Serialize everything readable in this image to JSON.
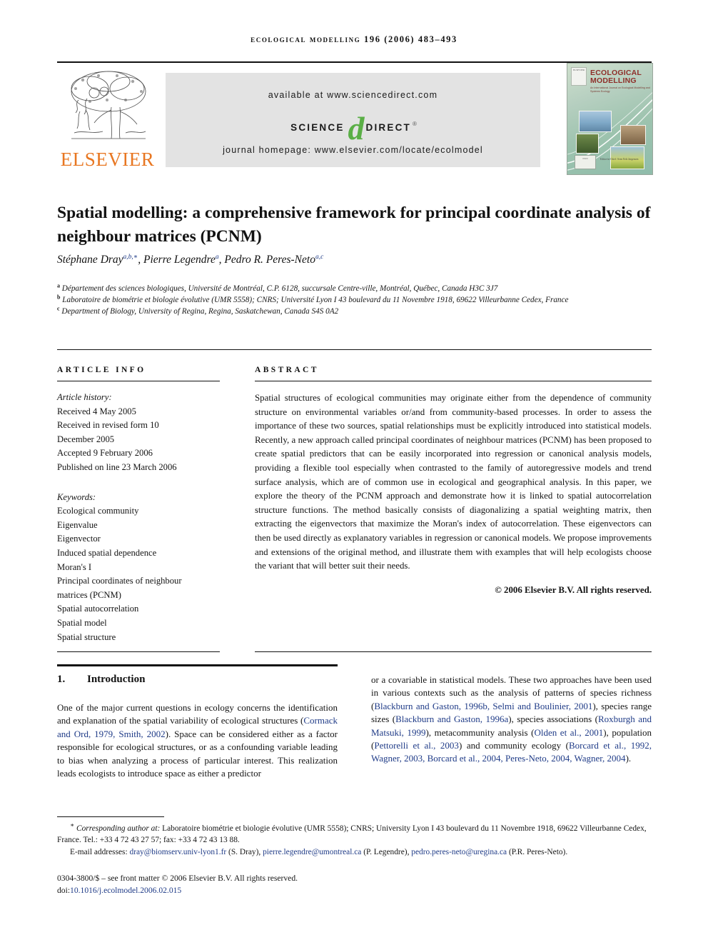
{
  "running_head": "Ecological Modelling 196 (2006) 483–493",
  "banner": {
    "publisher_name": "ELSEVIER",
    "available_at": "available at www.sciencedirect.com",
    "sciencedirect_science": "SCIENCE",
    "sciencedirect_d": "d",
    "sciencedirect_direct": "DIRECT",
    "sciencedirect_reg": "®",
    "journal_homepage": "journal homepage: www.elsevier.com/locate/ecolmodel",
    "cover": {
      "publisher_block": "ELSEVIER",
      "title": "ECOLOGICAL MODELLING",
      "subtitle": "An International Journal on Ecological Modelling and Systems Ecology",
      "issn_block": "ISSN",
      "editor": "Editor-in-Chief: Sven Erik Jørgensen"
    }
  },
  "article": {
    "title": "Spatial modelling: a comprehensive framework for principal coordinate analysis of neighbour matrices (PCNM)",
    "authors_html": "Stéphane Dray<sup>a,b,∗</sup>, Pierre Legendre<sup>a</sup>, Pedro R. Peres-Neto<sup>a,c</sup>",
    "affiliations": [
      {
        "marker": "a",
        "text": "Département des sciences biologiques, Université de Montréal, C.P. 6128, succursale Centre-ville, Montréal, Québec, Canada H3C 3J7"
      },
      {
        "marker": "b",
        "text": "Laboratoire de biométrie et biologie évolutive (UMR 5558); CNRS; Université Lyon I 43 boulevard du 11 Novembre 1918, 69622 Villeurbanne Cedex, France"
      },
      {
        "marker": "c",
        "text": "Department of Biology, University of Regina, Regina, Saskatchewan, Canada S4S 0A2"
      }
    ]
  },
  "article_info": {
    "label": "ARTICLE INFO",
    "history_label": "Article history:",
    "history": [
      "Received 4 May 2005",
      "Received in revised form 10",
      "December 2005",
      "Accepted 9 February 2006",
      "Published on line 23 March 2006"
    ],
    "keywords_label": "Keywords:",
    "keywords": [
      "Ecological community",
      "Eigenvalue",
      "Eigenvector",
      "Induced spatial dependence",
      "Moran's I",
      "Principal coordinates of neighbour",
      "matrices (PCNM)",
      "Spatial autocorrelation",
      "Spatial model",
      "Spatial structure"
    ]
  },
  "abstract": {
    "label": "ABSTRACT",
    "text": "Spatial structures of ecological communities may originate either from the dependence of community structure on environmental variables or/and from community-based processes. In order to assess the importance of these two sources, spatial relationships must be explicitly introduced into statistical models. Recently, a new approach called principal coordinates of neighbour matrices (PCNM) has been proposed to create spatial predictors that can be easily incorporated into regression or canonical analysis models, providing a flexible tool especially when contrasted to the family of autoregressive models and trend surface analysis, which are of common use in ecological and geographical analysis. In this paper, we explore the theory of the PCNM approach and demonstrate how it is linked to spatial autocorrelation structure functions. The method basically consists of diagonalizing a spatial weighting matrix, then extracting the eigenvectors that maximize the Moran's index of autocorrelation. These eigenvectors can then be used directly as explanatory variables in regression or canonical models. We propose improvements and extensions of the original method, and illustrate them with examples that will help ecologists choose the variant that will better suit their needs.",
    "copyright": "© 2006 Elsevier B.V. All rights reserved."
  },
  "introduction": {
    "number": "1.",
    "heading": "Introduction",
    "left_column_html": "One of the major current questions in ecology concerns the identification and explanation of the spatial variability of ecological structures (<span class=\"cit\">Cormack and Ord, 1979, Smith, 2002</span>). Space can be considered either as a factor responsible for ecological structures, or as a confounding variable leading to bias when analyzing a process of particular interest. This realization leads ecologists to introduce space as either a predictor",
    "right_column_html": "or a covariable in statistical models. These two approaches have been used in various contexts such as the analysis of patterns of species richness (<span class=\"cit\">Blackburn and Gaston, 1996b, Selmi and Boulinier, 2001</span>), species range sizes (<span class=\"cit\">Blackburn and Gaston, 1996a</span>), species associations (<span class=\"cit\">Roxburgh and Matsuki, 1999</span>), metacommunity analysis (<span class=\"cit\">Olden et al., 2001</span>), population (<span class=\"cit\">Pettorelli et al., 2003</span>) and community ecology (<span class=\"cit\">Borcard et al., 1992, Wagner, 2003, Borcard et al., 2004, Peres-Neto, 2004, Wagner, 2004</span>)."
  },
  "footnotes": {
    "corresponding_html": "<sup>∗</sup> <span class=\"corr\">Corresponding author at:</span> Laboratoire biométrie et biologie évolutive (UMR 5558); CNRS; University Lyon I 43 boulevard du 11 Novembre 1918, 69622 Villeurbanne Cedex, France. Tel.: +33 4 72 43 27 57; fax: +33 4 72 43 13 88.",
    "emails_html": "E-mail addresses: <span class=\"link\">dray@biomserv.univ-lyon1.fr</span> (S. Dray), <span class=\"link\">pierre.legendre@umontreal.ca</span> (P. Legendre), <span class=\"link\">pedro.peres-neto@uregina.ca</span> (P.R. Peres-Neto)."
  },
  "imprint": {
    "front_matter": "0304-3800/$ – see front matter © 2006 Elsevier B.V. All rights reserved.",
    "doi_prefix": "doi:",
    "doi_value": "10.1016/j.ecolmodel.2006.02.015"
  }
}
